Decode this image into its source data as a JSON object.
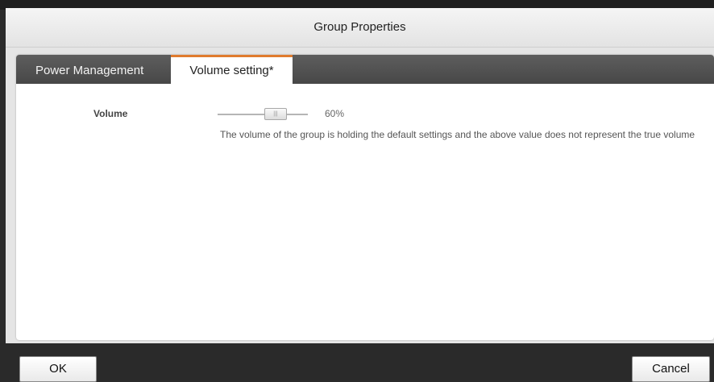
{
  "dialog": {
    "title": "Group Properties"
  },
  "tabs": [
    {
      "label": "Power Management",
      "active": false
    },
    {
      "label": "Volume setting*",
      "active": true
    }
  ],
  "volume": {
    "label": "Volume",
    "value_text": "60%",
    "value": 60,
    "thumb_grip": "|||",
    "description": "The volume of the group is holding the default settings and the above value does not represent the true volume"
  },
  "buttons": {
    "ok": "OK",
    "cancel": "Cancel"
  },
  "colors": {
    "accent": "#e07b2e",
    "tabbar": "#4f4f4f",
    "footer": "#2a2a2a"
  }
}
